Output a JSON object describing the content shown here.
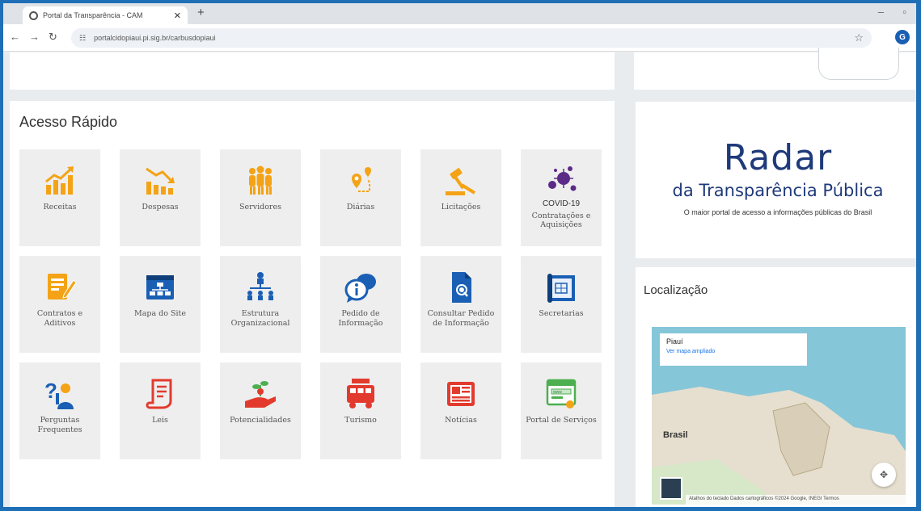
{
  "browser": {
    "tab_title": "Portal da Transparência - CAM",
    "new_tab": "+",
    "url": "portalcidopiaui.pi.sig.br/carbusdopiaui",
    "profile_initial": "G",
    "min_glyph": "–",
    "max_glyph": "▫"
  },
  "quick_access": {
    "title": "Acesso Rápido",
    "items": [
      {
        "label": "Receitas",
        "icon": "chart-up-icon"
      },
      {
        "label": "Despesas",
        "icon": "chart-down-icon"
      },
      {
        "label": "Servidores",
        "icon": "people-icon"
      },
      {
        "label": "Diárias",
        "icon": "route-pin-icon"
      },
      {
        "label": "Licitações",
        "icon": "gavel-icon"
      },
      {
        "label": "COVID-19",
        "sublabel": "Contratações e Aquisições",
        "icon": "virus-icon"
      },
      {
        "label": "Contratos e Aditivos",
        "icon": "contract-icon"
      },
      {
        "label": "Mapa do Site",
        "icon": "sitemap-icon"
      },
      {
        "label": "Estrutura Organizacional",
        "icon": "org-chart-icon"
      },
      {
        "label": "Pedido de Informação",
        "icon": "chat-info-icon"
      },
      {
        "label": "Consultar Pedido de Informação",
        "icon": "doc-search-icon"
      },
      {
        "label": "Secretarias",
        "icon": "blueprint-icon"
      },
      {
        "label": "Perguntas Frequentes",
        "icon": "faq-icon"
      },
      {
        "label": "Leis",
        "icon": "scroll-icon"
      },
      {
        "label": "Potencialidades",
        "icon": "plant-hand-icon"
      },
      {
        "label": "Turismo",
        "icon": "bus-icon"
      },
      {
        "label": "Notícias",
        "icon": "newspaper-icon"
      },
      {
        "label": "Portal de Serviços",
        "icon": "web-window-icon"
      }
    ]
  },
  "radar": {
    "title": "Radar",
    "subtitle": "da Transparência Pública",
    "tagline": "O maior portal de acesso a informações públicas do Brasil"
  },
  "location": {
    "title": "Localização",
    "map_place": "Piauí",
    "map_link": "Ver mapa ampliado",
    "map_country": "Brasil",
    "map_footer": "Atalhos do teclado   Dados cartográficos ©2024 Google, INEGI   Termos"
  },
  "colors": {
    "orange": "#f4a316",
    "blue": "#1a5fb4",
    "red": "#e23b2e",
    "green": "#4caf50",
    "purple": "#5b2a86",
    "radar_blue": "#1f3a7a",
    "frame_blue": "#1f6fb7"
  }
}
